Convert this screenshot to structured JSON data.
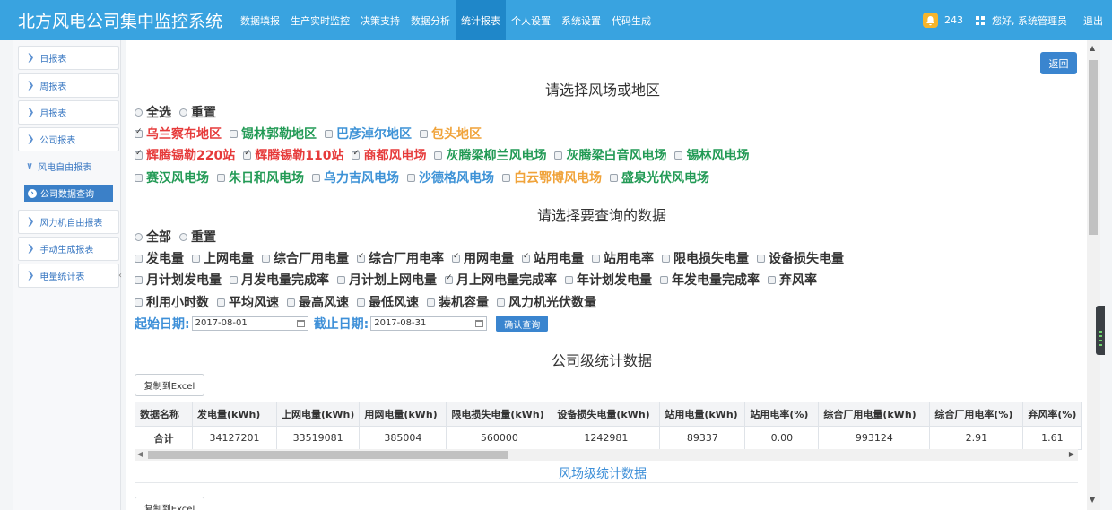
{
  "header": {
    "brand": "北方风电公司集中监控系统",
    "nav": [
      "数据填报",
      "生产实时监控",
      "决策支持",
      "数据分析",
      "统计报表",
      "个人设置",
      "系统设置",
      "代码生成"
    ],
    "active_nav": "统计报表",
    "notification_count": "243",
    "user": "您好, 系统管理员",
    "logout": "退出"
  },
  "sidebar": {
    "items": [
      "日报表",
      "周报表",
      "月报表",
      "公司报表"
    ],
    "open_group": "风电自由报表",
    "active_item": "公司数据查询",
    "more_items": [
      "风力机自由报表",
      "手动生成报表",
      "电量统计表"
    ]
  },
  "main": {
    "back": "返回",
    "section1_title": "请选择风场或地区",
    "select_all": "全选",
    "reset": "重置",
    "regions": [
      {
        "label": "乌兰察布地区",
        "checked": true,
        "color": "red"
      },
      {
        "label": "锡林郭勒地区",
        "checked": false,
        "color": "green"
      },
      {
        "label": "巴彦淖尔地区",
        "checked": false,
        "color": "blue"
      },
      {
        "label": "包头地区",
        "checked": false,
        "color": "orange"
      }
    ],
    "farms_row1": [
      {
        "label": "辉腾锡勒220站",
        "checked": true,
        "color": "red"
      },
      {
        "label": "辉腾锡勒110站",
        "checked": true,
        "color": "red"
      },
      {
        "label": "商都风电场",
        "checked": true,
        "color": "red"
      },
      {
        "label": "灰腾梁柳兰风电场",
        "checked": false,
        "color": "green"
      },
      {
        "label": "灰腾梁白音风电场",
        "checked": false,
        "color": "green"
      },
      {
        "label": "锡林风电场",
        "checked": false,
        "color": "green"
      }
    ],
    "farms_row2": [
      {
        "label": "赛汉风电场",
        "checked": false,
        "color": "green"
      },
      {
        "label": "朱日和风电场",
        "checked": false,
        "color": "green"
      },
      {
        "label": "乌力吉风电场",
        "checked": false,
        "color": "blue"
      },
      {
        "label": "沙德格风电场",
        "checked": false,
        "color": "blue"
      },
      {
        "label": "白云鄂博风电场",
        "checked": false,
        "color": "orange"
      },
      {
        "label": "盛泉光伏风电场",
        "checked": false,
        "color": "green"
      }
    ],
    "section2_title": "请选择要查询的数据",
    "select_all2": "全部",
    "reset2": "重置",
    "metrics_row1": [
      {
        "label": "发电量",
        "checked": false
      },
      {
        "label": "上网电量",
        "checked": false
      },
      {
        "label": "综合厂用电量",
        "checked": false
      },
      {
        "label": "综合厂用电率",
        "checked": true
      },
      {
        "label": "用网电量",
        "checked": true
      },
      {
        "label": "站用电量",
        "checked": true
      },
      {
        "label": "站用电率",
        "checked": false
      },
      {
        "label": "限电损失电量",
        "checked": false
      },
      {
        "label": "设备损失电量",
        "checked": false
      }
    ],
    "metrics_row2": [
      {
        "label": "月计划发电量",
        "checked": false
      },
      {
        "label": "月发电量完成率",
        "checked": false
      },
      {
        "label": "月计划上网电量",
        "checked": false
      },
      {
        "label": "月上网电量完成率",
        "checked": true
      },
      {
        "label": "年计划发电量",
        "checked": false
      },
      {
        "label": "年发电量完成率",
        "checked": false
      },
      {
        "label": "弃风率",
        "checked": false
      }
    ],
    "metrics_row3": [
      {
        "label": "利用小时数",
        "checked": false
      },
      {
        "label": "平均风速",
        "checked": false
      },
      {
        "label": "最高风速",
        "checked": false
      },
      {
        "label": "最低风速",
        "checked": false
      },
      {
        "label": "装机容量",
        "checked": false
      },
      {
        "label": "风力机光伏数量",
        "checked": false
      }
    ],
    "start_label": "起始日期:",
    "start_date": "2017-08-01",
    "end_label": "截止日期:",
    "end_date": "2017-08-31",
    "confirm": "确认查询",
    "company_title": "公司级统计数据",
    "copy_excel": "复制到Excel",
    "table": {
      "headers": [
        "数据名称",
        "发电量(kWh)",
        "上网电量(kWh)",
        "用网电量(kWh)",
        "限电损失电量(kWh)",
        "设备损失电量(kWh)",
        "站用电量(kWh)",
        "站用电率(%)",
        "综合厂用电量(kWh)",
        "综合厂用电率(%)",
        "弃风率(%)"
      ],
      "rows": [
        [
          "合计",
          "34127201",
          "33519081",
          "385004",
          "560000",
          "1242981",
          "89337",
          "0.00",
          "993124",
          "2.91",
          "1.61"
        ]
      ]
    },
    "farm_title": "风场级统计数据",
    "copy_excel2": "复制到Excel"
  },
  "colors": {
    "red": "#e63b3b",
    "green": "#229a55",
    "blue": "#3d92d6",
    "orange": "#f0a33a",
    "nav": "#39a3e0",
    "accent": "#3a85cf"
  }
}
